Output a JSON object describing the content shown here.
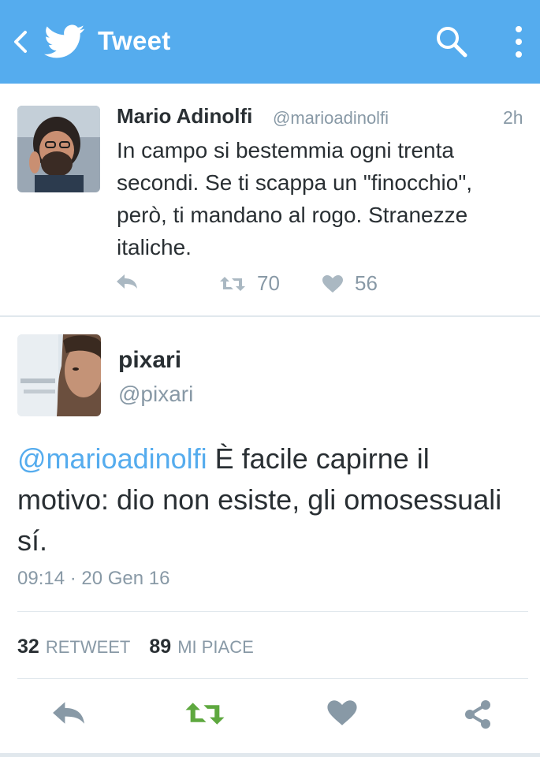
{
  "header": {
    "title": "Tweet",
    "color": "#55acee",
    "icons": [
      "back-arrow-icon",
      "twitter-bird-icon",
      "search-icon",
      "more-vertical-icon"
    ]
  },
  "parent_tweet": {
    "name": "Mario Adinolfi",
    "handle": "@marioadinolfi",
    "time": "2h",
    "text": "In campo si bestemmia ogni trenta secondi. Se ti scappa un \"finocchio\", però, ti mandano al rogo. Stranezze italiche.",
    "retweets": "70",
    "likes": "56"
  },
  "focus_tweet": {
    "name": "pixari",
    "handle": "@pixari",
    "mention": "@marioadinolfi",
    "text": " È facile capirne il motivo: dio non esiste, gli omosessuali sí.",
    "timestamp": "09:14 · 20 Gen 16",
    "retweet_count": "32",
    "retweet_label": "RETWEET",
    "like_count": "89",
    "like_label": "MI PIACE"
  },
  "colors": {
    "accent": "#55acee",
    "retweet_green": "#5ea83f",
    "muted": "#8899a6",
    "text": "#292f33"
  }
}
